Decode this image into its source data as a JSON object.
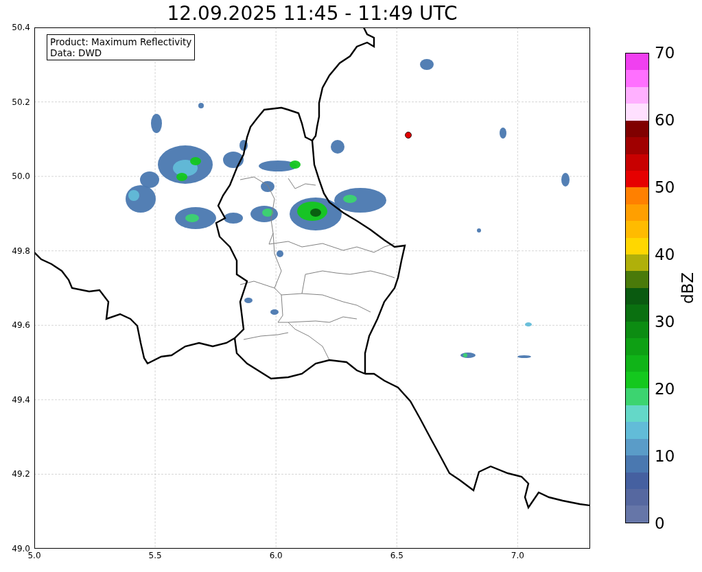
{
  "title": "12.09.2025 11:45 - 11:49 UTC",
  "map": {
    "info_box": [
      "Product: Maximum Reflectivity",
      "Data: DWD"
    ],
    "yticks": [
      "50.4",
      "50.2",
      "50.0",
      "49.8",
      "49.6",
      "49.4",
      "49.2",
      "49.0"
    ],
    "xticks": [
      "5.0",
      "5.5",
      "6.0",
      "6.5",
      "7.0"
    ]
  },
  "colorbar": {
    "label": "dBZ",
    "ticks": [
      "70",
      "60",
      "50",
      "40",
      "30",
      "20",
      "10",
      "0"
    ],
    "segments": [
      {
        "color": "#f040f0"
      },
      {
        "color": "#ff70ff"
      },
      {
        "color": "#ffb0ff"
      },
      {
        "color": "#ffe0ff"
      },
      {
        "color": "#800000"
      },
      {
        "color": "#a00000"
      },
      {
        "color": "#c80000"
      },
      {
        "color": "#e60000"
      },
      {
        "color": "#ff8000"
      },
      {
        "color": "#ff9f00"
      },
      {
        "color": "#ffbb00"
      },
      {
        "color": "#ffd700"
      },
      {
        "color": "#b0b00a"
      },
      {
        "color": "#4a7a0a"
      },
      {
        "color": "#0a5a10"
      },
      {
        "color": "#0a7010"
      },
      {
        "color": "#0c8c12"
      },
      {
        "color": "#0ea014"
      },
      {
        "color": "#10b418"
      },
      {
        "color": "#14c81e"
      },
      {
        "color": "#3cd470"
      },
      {
        "color": "#64d8c8"
      },
      {
        "color": "#62bcd8"
      },
      {
        "color": "#5a9cc8"
      },
      {
        "color": "#4a78b0"
      },
      {
        "color": "#4560a0"
      },
      {
        "color": "#5668a0"
      },
      {
        "color": "#6676a8"
      }
    ]
  }
}
